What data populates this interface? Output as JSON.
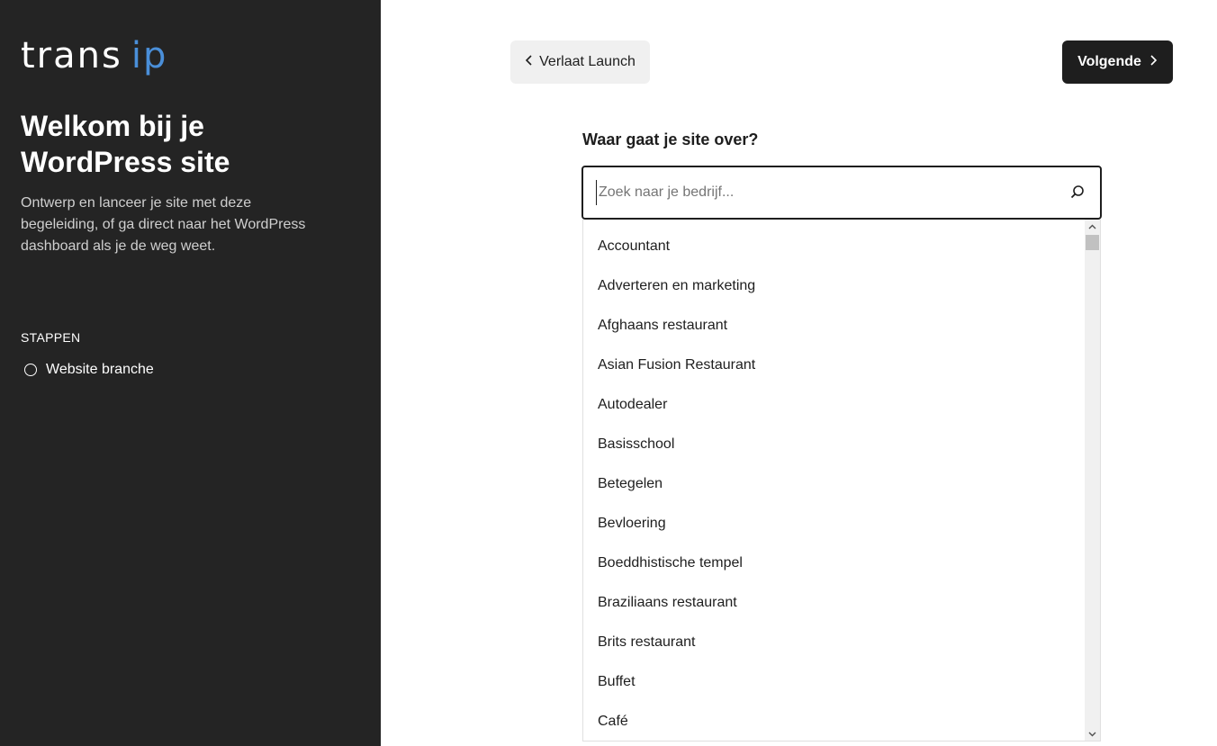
{
  "sidebar": {
    "logo_part1": "trans",
    "logo_part2": "ip",
    "title": "Welkom bij je WordPress site",
    "description": "Ontwerp en lanceer je site met deze begeleiding, of ga direct naar het WordPress dashboard als je de weg weet.",
    "steps_heading": "STAPPEN",
    "steps": [
      {
        "label": "Website branche"
      }
    ]
  },
  "toolbar": {
    "back_label": "Verlaat Launch",
    "next_label": "Volgende"
  },
  "main": {
    "question": "Waar gaat je site over?",
    "search": {
      "placeholder": "Zoek naar je bedrijf...",
      "value": ""
    },
    "options": [
      "Accountant",
      "Adverteren en marketing",
      "Afghaans restaurant",
      "Asian Fusion Restaurant",
      "Autodealer",
      "Basisschool",
      "Betegelen",
      "Bevloering",
      "Boeddhistische tempel",
      "Braziliaans restaurant",
      "Brits restaurant",
      "Buffet",
      "Café"
    ]
  },
  "colors": {
    "sidebar_bg": "#242424",
    "logo_accent": "#4a8fd9",
    "primary_button": "#1e1e1e",
    "secondary_button": "#f0f0f0"
  },
  "icons": [
    "chevron-left-icon",
    "chevron-right-icon",
    "search-icon",
    "step-circle-icon",
    "scroll-up-icon",
    "scroll-down-icon"
  ]
}
